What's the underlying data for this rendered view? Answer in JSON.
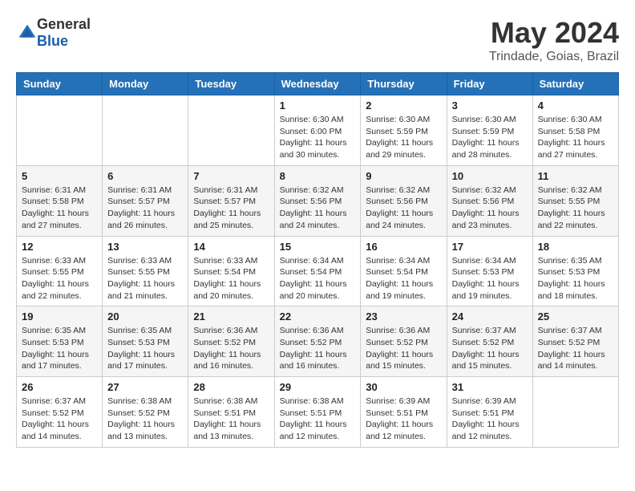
{
  "header": {
    "logo_general": "General",
    "logo_blue": "Blue",
    "month_title": "May 2024",
    "location": "Trindade, Goias, Brazil"
  },
  "days_of_week": [
    "Sunday",
    "Monday",
    "Tuesday",
    "Wednesday",
    "Thursday",
    "Friday",
    "Saturday"
  ],
  "weeks": [
    [
      {
        "day": "",
        "info": ""
      },
      {
        "day": "",
        "info": ""
      },
      {
        "day": "",
        "info": ""
      },
      {
        "day": "1",
        "info": "Sunrise: 6:30 AM\nSunset: 6:00 PM\nDaylight: 11 hours\nand 30 minutes."
      },
      {
        "day": "2",
        "info": "Sunrise: 6:30 AM\nSunset: 5:59 PM\nDaylight: 11 hours\nand 29 minutes."
      },
      {
        "day": "3",
        "info": "Sunrise: 6:30 AM\nSunset: 5:59 PM\nDaylight: 11 hours\nand 28 minutes."
      },
      {
        "day": "4",
        "info": "Sunrise: 6:30 AM\nSunset: 5:58 PM\nDaylight: 11 hours\nand 27 minutes."
      }
    ],
    [
      {
        "day": "5",
        "info": "Sunrise: 6:31 AM\nSunset: 5:58 PM\nDaylight: 11 hours\nand 27 minutes."
      },
      {
        "day": "6",
        "info": "Sunrise: 6:31 AM\nSunset: 5:57 PM\nDaylight: 11 hours\nand 26 minutes."
      },
      {
        "day": "7",
        "info": "Sunrise: 6:31 AM\nSunset: 5:57 PM\nDaylight: 11 hours\nand 25 minutes."
      },
      {
        "day": "8",
        "info": "Sunrise: 6:32 AM\nSunset: 5:56 PM\nDaylight: 11 hours\nand 24 minutes."
      },
      {
        "day": "9",
        "info": "Sunrise: 6:32 AM\nSunset: 5:56 PM\nDaylight: 11 hours\nand 24 minutes."
      },
      {
        "day": "10",
        "info": "Sunrise: 6:32 AM\nSunset: 5:56 PM\nDaylight: 11 hours\nand 23 minutes."
      },
      {
        "day": "11",
        "info": "Sunrise: 6:32 AM\nSunset: 5:55 PM\nDaylight: 11 hours\nand 22 minutes."
      }
    ],
    [
      {
        "day": "12",
        "info": "Sunrise: 6:33 AM\nSunset: 5:55 PM\nDaylight: 11 hours\nand 22 minutes."
      },
      {
        "day": "13",
        "info": "Sunrise: 6:33 AM\nSunset: 5:55 PM\nDaylight: 11 hours\nand 21 minutes."
      },
      {
        "day": "14",
        "info": "Sunrise: 6:33 AM\nSunset: 5:54 PM\nDaylight: 11 hours\nand 20 minutes."
      },
      {
        "day": "15",
        "info": "Sunrise: 6:34 AM\nSunset: 5:54 PM\nDaylight: 11 hours\nand 20 minutes."
      },
      {
        "day": "16",
        "info": "Sunrise: 6:34 AM\nSunset: 5:54 PM\nDaylight: 11 hours\nand 19 minutes."
      },
      {
        "day": "17",
        "info": "Sunrise: 6:34 AM\nSunset: 5:53 PM\nDaylight: 11 hours\nand 19 minutes."
      },
      {
        "day": "18",
        "info": "Sunrise: 6:35 AM\nSunset: 5:53 PM\nDaylight: 11 hours\nand 18 minutes."
      }
    ],
    [
      {
        "day": "19",
        "info": "Sunrise: 6:35 AM\nSunset: 5:53 PM\nDaylight: 11 hours\nand 17 minutes."
      },
      {
        "day": "20",
        "info": "Sunrise: 6:35 AM\nSunset: 5:53 PM\nDaylight: 11 hours\nand 17 minutes."
      },
      {
        "day": "21",
        "info": "Sunrise: 6:36 AM\nSunset: 5:52 PM\nDaylight: 11 hours\nand 16 minutes."
      },
      {
        "day": "22",
        "info": "Sunrise: 6:36 AM\nSunset: 5:52 PM\nDaylight: 11 hours\nand 16 minutes."
      },
      {
        "day": "23",
        "info": "Sunrise: 6:36 AM\nSunset: 5:52 PM\nDaylight: 11 hours\nand 15 minutes."
      },
      {
        "day": "24",
        "info": "Sunrise: 6:37 AM\nSunset: 5:52 PM\nDaylight: 11 hours\nand 15 minutes."
      },
      {
        "day": "25",
        "info": "Sunrise: 6:37 AM\nSunset: 5:52 PM\nDaylight: 11 hours\nand 14 minutes."
      }
    ],
    [
      {
        "day": "26",
        "info": "Sunrise: 6:37 AM\nSunset: 5:52 PM\nDaylight: 11 hours\nand 14 minutes."
      },
      {
        "day": "27",
        "info": "Sunrise: 6:38 AM\nSunset: 5:52 PM\nDaylight: 11 hours\nand 13 minutes."
      },
      {
        "day": "28",
        "info": "Sunrise: 6:38 AM\nSunset: 5:51 PM\nDaylight: 11 hours\nand 13 minutes."
      },
      {
        "day": "29",
        "info": "Sunrise: 6:38 AM\nSunset: 5:51 PM\nDaylight: 11 hours\nand 12 minutes."
      },
      {
        "day": "30",
        "info": "Sunrise: 6:39 AM\nSunset: 5:51 PM\nDaylight: 11 hours\nand 12 minutes."
      },
      {
        "day": "31",
        "info": "Sunrise: 6:39 AM\nSunset: 5:51 PM\nDaylight: 11 hours\nand 12 minutes."
      },
      {
        "day": "",
        "info": ""
      }
    ]
  ]
}
